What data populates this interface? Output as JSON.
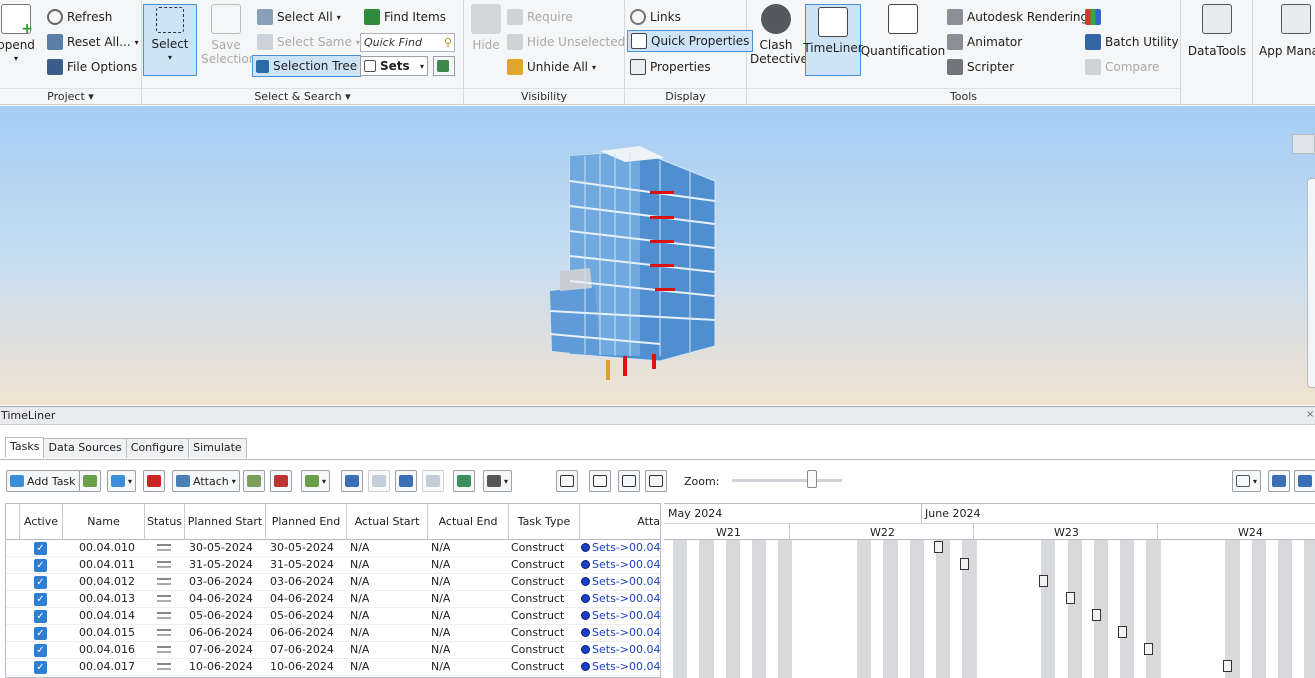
{
  "ribbon": {
    "project": {
      "label": "Project",
      "append": "ppend",
      "refresh": "Refresh",
      "reset_all": "Reset All...",
      "file_options": "File Options"
    },
    "select_search": {
      "label": "Select & Search",
      "select": "Select",
      "save_selection": "Save Selection",
      "select_all": "Select All",
      "select_same": "Select Same",
      "selection_tree": "Selection Tree",
      "find_items": "Find Items",
      "quick_find_placeholder": "Quick Find",
      "sets": "Sets"
    },
    "visibility": {
      "label": "Visibility",
      "hide": "Hide",
      "require": "Require",
      "hide_unselected": "Hide Unselected",
      "unhide_all": "Unhide All"
    },
    "display": {
      "label": "Display",
      "links": "Links",
      "quick_properties": "Quick Properties",
      "properties": "Properties"
    },
    "tools": {
      "label": "Tools",
      "clash_detective": "Clash Detective",
      "timeliner": "TimeLiner",
      "quantification": "Quantification",
      "autodesk_rendering": "Autodesk Rendering",
      "animator": "Animator",
      "scripter": "Scripter",
      "batch_utility": "Batch Utility",
      "compare": "Compare",
      "datatools": "DataTools",
      "app_manager": "App Mana"
    }
  },
  "timeliner": {
    "title": "TimeLiner",
    "tabs": [
      "Tasks",
      "Data Sources",
      "Configure",
      "Simulate"
    ],
    "toolbar": {
      "add_task": "Add Task",
      "attach": "Attach",
      "zoom": "Zoom:"
    },
    "columns": [
      "Active",
      "Name",
      "Status",
      "Planned Start",
      "Planned End",
      "Actual Start",
      "Actual End",
      "Task Type",
      "Atta"
    ],
    "rows": [
      {
        "name": "00.04.010",
        "start": "30-05-2024",
        "end": "30-05-2024",
        "astart": "N/A",
        "aend": "N/A",
        "type": "Construct",
        "attached": "Sets->00.04."
      },
      {
        "name": "00.04.011",
        "start": "31-05-2024",
        "end": "31-05-2024",
        "astart": "N/A",
        "aend": "N/A",
        "type": "Construct",
        "attached": "Sets->00.04."
      },
      {
        "name": "00.04.012",
        "start": "03-06-2024",
        "end": "03-06-2024",
        "astart": "N/A",
        "aend": "N/A",
        "type": "Construct",
        "attached": "Sets->00.04."
      },
      {
        "name": "00.04.013",
        "start": "04-06-2024",
        "end": "04-06-2024",
        "astart": "N/A",
        "aend": "N/A",
        "type": "Construct",
        "attached": "Sets->00.04."
      },
      {
        "name": "00.04.014",
        "start": "05-06-2024",
        "end": "05-06-2024",
        "astart": "N/A",
        "aend": "N/A",
        "type": "Construct",
        "attached": "Sets->00.04."
      },
      {
        "name": "00.04.015",
        "start": "06-06-2024",
        "end": "06-06-2024",
        "astart": "N/A",
        "aend": "N/A",
        "type": "Construct",
        "attached": "Sets->00.04."
      },
      {
        "name": "00.04.016",
        "start": "07-06-2024",
        "end": "07-06-2024",
        "astart": "N/A",
        "aend": "N/A",
        "type": "Construct",
        "attached": "Sets->00.04."
      },
      {
        "name": "00.04.017",
        "start": "10-06-2024",
        "end": "10-06-2024",
        "astart": "N/A",
        "aend": "N/A",
        "type": "Construct",
        "attached": "Sets->00.04."
      }
    ],
    "gantt": {
      "months": [
        "May 2024",
        "June 2024"
      ],
      "weeks": [
        "W21",
        "W22",
        "W23",
        "W24"
      ]
    }
  },
  "colors": {
    "accent": "#2d7fd6",
    "selected_bg": "#cde4f7",
    "sky_top": "#a4cdf4",
    "sky_bottom": "#f2e2cf"
  }
}
